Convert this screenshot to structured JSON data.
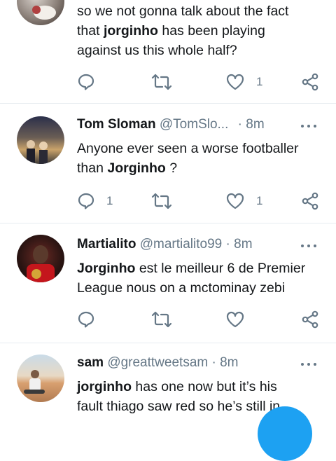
{
  "tweets": [
    {
      "name": "",
      "handle": "",
      "time": "",
      "text_lines": [
        "so we not gonna talk about the fact",
        "that ",
        "jorginho",
        " has been playing",
        "against us this whole half?"
      ],
      "reply_count": "",
      "like_count": "1"
    },
    {
      "name": "Tom Sloman",
      "handle": "@TomSlo...",
      "sep": "·",
      "time": "8m",
      "text": [
        "Anyone ever seen a worse footballer",
        "than ",
        "Jorginho",
        " ?"
      ],
      "reply_count": "1",
      "like_count": "1"
    },
    {
      "name": "Martialito",
      "handle": "@martialito99",
      "sep": "·",
      "time": "8m",
      "text": [
        "Jorginho",
        " est le meilleur 6 de Premier",
        "League nous on a mctominay zebi"
      ],
      "reply_count": "",
      "like_count": ""
    },
    {
      "name": "sam",
      "handle": "@greattweetsam",
      "sep": "·",
      "time": "8m",
      "text": [
        "jorginho",
        " has one now but it’s his",
        "fault thiago saw red so he’s still in"
      ]
    }
  ],
  "colors": {
    "accent": "#1da1f2",
    "muted": "#657786",
    "divider": "#e6ecf0"
  },
  "icons": [
    "reply-icon",
    "retweet-icon",
    "like-icon",
    "share-icon",
    "more-icon",
    "compose-fab"
  ]
}
